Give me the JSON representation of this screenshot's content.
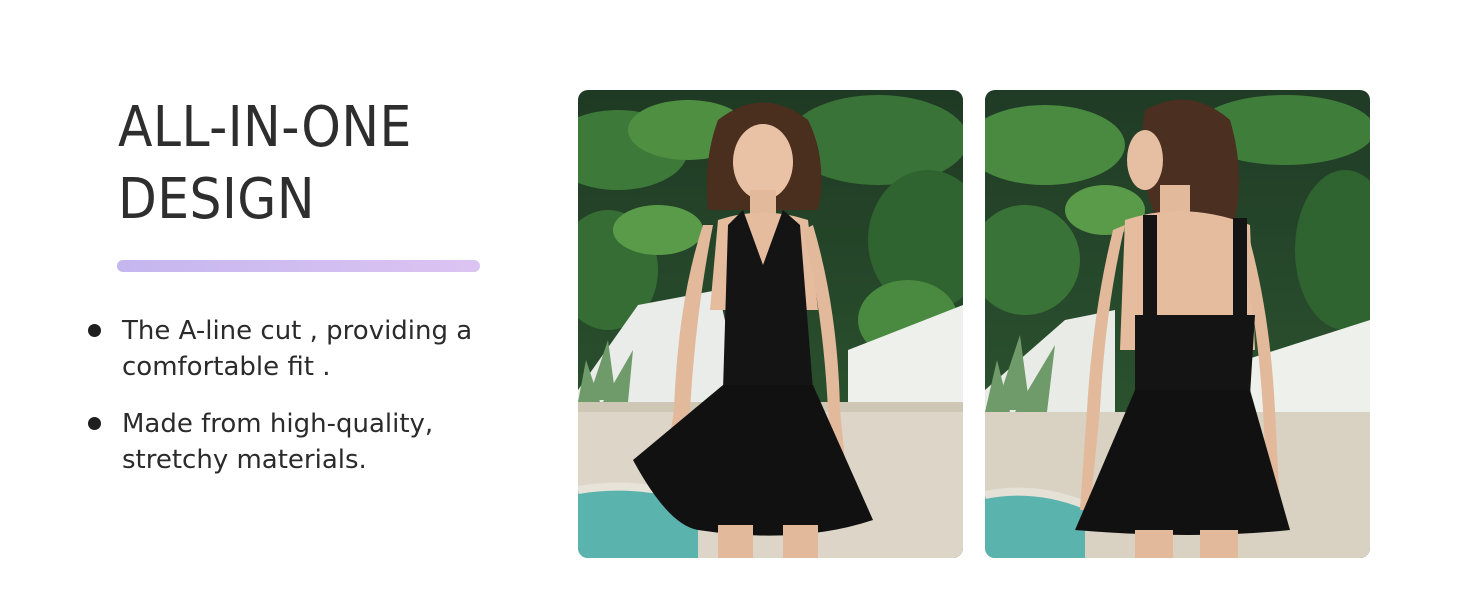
{
  "heading": {
    "line1": "ALL-IN-ONE",
    "line2": "DESIGN"
  },
  "accent_colors": [
    "#c5b6ef",
    "#dcc4f2"
  ],
  "features": [
    {
      "line1": "The A-line cut , providing a",
      "line2": "comfortable fit ."
    },
    {
      "line1": "Made from high-quality,",
      "line2": "stretchy materials."
    }
  ],
  "photos": [
    {
      "subject": "front-view-photo"
    },
    {
      "subject": "back-view-photo"
    }
  ]
}
